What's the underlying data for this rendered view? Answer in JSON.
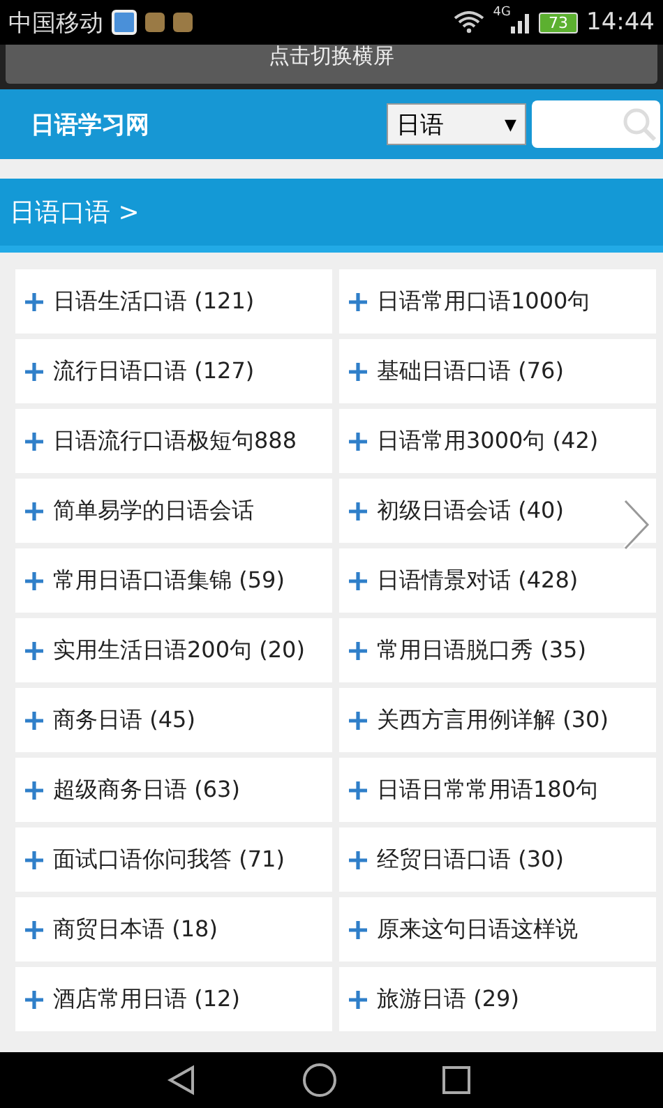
{
  "status_bar": {
    "carrier": "中国移动",
    "network": "4G",
    "battery": "73",
    "time": "14:44"
  },
  "banner": {
    "label": "点击切换横屏"
  },
  "header": {
    "title": "日语学习网",
    "select": {
      "value": "日语",
      "arrow": "▼"
    }
  },
  "breadcrumb": {
    "label": "日语口语 >"
  },
  "categories": [
    {
      "label": "日语生活口语 (121)"
    },
    {
      "label": "日语常用口语1000句"
    },
    {
      "label": "流行日语口语 (127)"
    },
    {
      "label": "基础日语口语 (76)"
    },
    {
      "label": "日语流行口语极短句888"
    },
    {
      "label": "日语常用3000句 (42)"
    },
    {
      "label": "简单易学的日语会话"
    },
    {
      "label": "初级日语会话 (40)"
    },
    {
      "label": "常用日语口语集锦 (59)"
    },
    {
      "label": "日语情景对话 (428)"
    },
    {
      "label": "实用生活日语200句 (20)"
    },
    {
      "label": "常用日语脱口秀 (35)"
    },
    {
      "label": "商务日语 (45)"
    },
    {
      "label": "关西方言用例详解 (30)"
    },
    {
      "label": "超级商务日语 (63)"
    },
    {
      "label": "日语日常常用语180句"
    },
    {
      "label": "面试口语你问我答 (71)"
    },
    {
      "label": "经贸日语口语 (30)"
    },
    {
      "label": "商贸日本语 (18)"
    },
    {
      "label": "原来这句日语这样说"
    },
    {
      "label": "酒店常用日语 (12)"
    },
    {
      "label": "旅游日语 (29)"
    }
  ]
}
